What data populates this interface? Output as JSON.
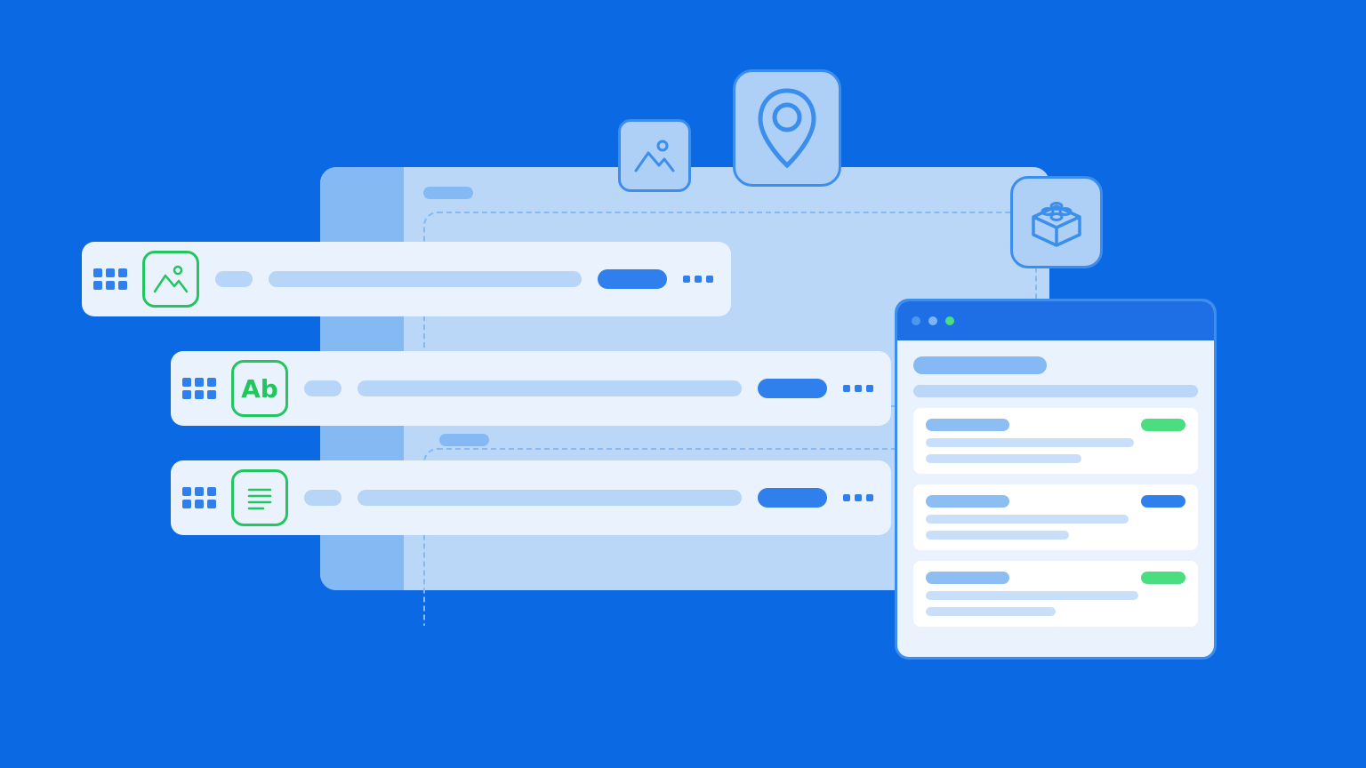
{
  "diagram": {
    "description": "Abstract illustration of a page-builder / field-editor UI with floating content-type chips and a preview window",
    "background_color": "#0B69E3",
    "back_panel": {
      "color": "#BAD7F8",
      "sidebar_color": "#85B9F3",
      "dashed_zones": 2
    },
    "floating_chips": [
      {
        "name": "image-chip",
        "icon": "image-icon"
      },
      {
        "name": "location-chip",
        "icon": "pin-icon"
      },
      {
        "name": "block-chip",
        "icon": "lego-block-icon"
      }
    ],
    "fields": [
      {
        "id": "field-image",
        "icon": "image-icon",
        "icon_label": ""
      },
      {
        "id": "field-text",
        "icon": "text-icon",
        "icon_label": "Ab"
      },
      {
        "id": "field-paragraph",
        "icon": "paragraph-icon",
        "icon_label": ""
      }
    ],
    "preview_window": {
      "traffic_lights": [
        "dim",
        "mid",
        "green"
      ],
      "cards": [
        {
          "badge_color": "#4ADE80"
        },
        {
          "badge_color": "#2F80ED"
        },
        {
          "badge_color": "#4ADE80"
        }
      ]
    },
    "palette": {
      "primary_blue": "#2F80ED",
      "light_blue": "#BAD7F8",
      "pale_blue": "#EAF3FD",
      "mid_blue": "#85B9F3",
      "green": "#22C55E",
      "badge_green": "#4ADE80"
    }
  }
}
